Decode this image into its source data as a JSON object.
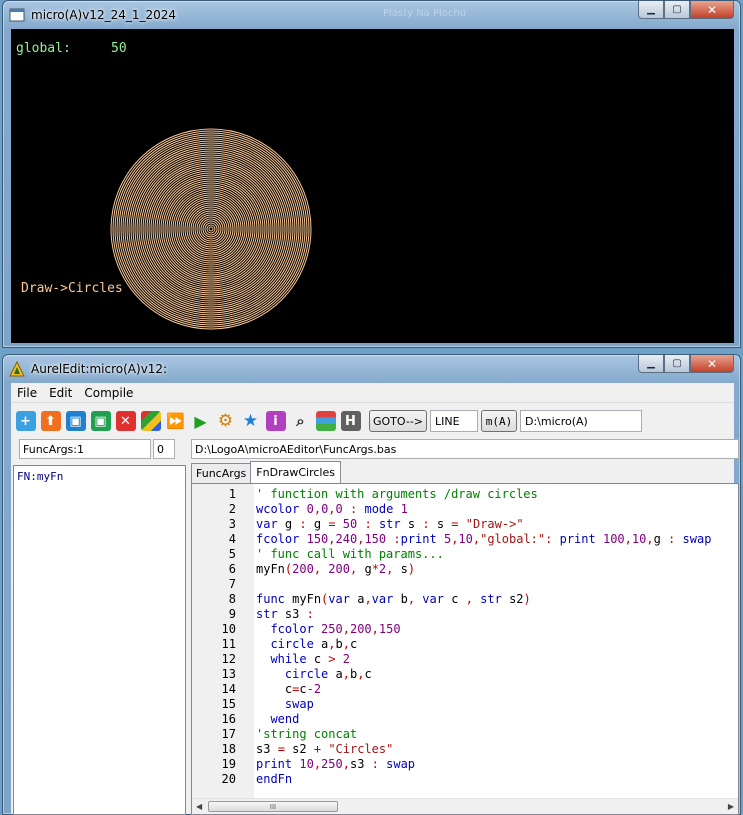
{
  "runtime_window": {
    "title": "micro(A)v12_24_1_2024",
    "watermark": "Plasty Na Plochu",
    "canvas": {
      "global_label": "global:",
      "global_value": "50",
      "circles_text": "Draw->Circles",
      "colors": {
        "background": "#000000",
        "label": "#96f096",
        "circles": "#fac896"
      }
    }
  },
  "editor_window": {
    "title": "AurelEdit:micro(A)v12:",
    "menu": [
      "File",
      "Edit",
      "Compile"
    ],
    "toolbar": {
      "icons": [
        "new-file-icon",
        "open-folder-icon",
        "save-icon",
        "save-as-icon",
        "close-icon",
        "plugins-icon",
        "fast-forward-icon",
        "run-icon",
        "settings-gear-icon",
        "star-icon",
        "info-icon",
        "search-icon",
        "list-options-icon",
        "help-h-icon"
      ],
      "goto_label": "GOTO-->",
      "line_value": "LINE",
      "ma_label": "m(A)",
      "path_value": "D:\\micro(A)"
    },
    "func_args_field": "FuncArgs:1",
    "number_field": "0",
    "file_path": "D:\\LogoA\\microAEditor\\FuncArgs.bas",
    "function_list": [
      "FN:myFn"
    ],
    "tabs": [
      {
        "label": "FuncArgs",
        "active": false
      },
      {
        "label": "FnDrawCircles",
        "active": true
      }
    ],
    "scroll_thumb_label": "III",
    "code_lines": [
      {
        "n": "1",
        "text": "' function with arguments /draw circles"
      },
      {
        "n": "2",
        "text": "wcolor 0,0,0 : mode 1"
      },
      {
        "n": "3",
        "text": "var g : g = 50 : str s : s = \"Draw->\""
      },
      {
        "n": "4",
        "text": "fcolor 150,240,150 :print 5,10,\"global:\": print 100,10,g : swap"
      },
      {
        "n": "5",
        "text": "' func call with params..."
      },
      {
        "n": "6",
        "text": "myFn(200, 200, g*2, s)"
      },
      {
        "n": "7",
        "text": ""
      },
      {
        "n": "8",
        "text": "func myFn(var a,var b, var c , str s2)"
      },
      {
        "n": "9",
        "text": "str s3 :"
      },
      {
        "n": "10",
        "text": "  fcolor 250,200,150"
      },
      {
        "n": "11",
        "text": "  circle a,b,c"
      },
      {
        "n": "12",
        "text": "  while c > 2"
      },
      {
        "n": "13",
        "text": "    circle a,b,c"
      },
      {
        "n": "14",
        "text": "    c=c-2"
      },
      {
        "n": "15",
        "text": "    swap"
      },
      {
        "n": "16",
        "text": "  wend"
      },
      {
        "n": "17",
        "text": "'string concat"
      },
      {
        "n": "18",
        "text": "s3 = s2 + \"Circles\""
      },
      {
        "n": "19",
        "text": "print 10,250,s3 : swap"
      },
      {
        "n": "20",
        "text": "endFn"
      }
    ]
  }
}
